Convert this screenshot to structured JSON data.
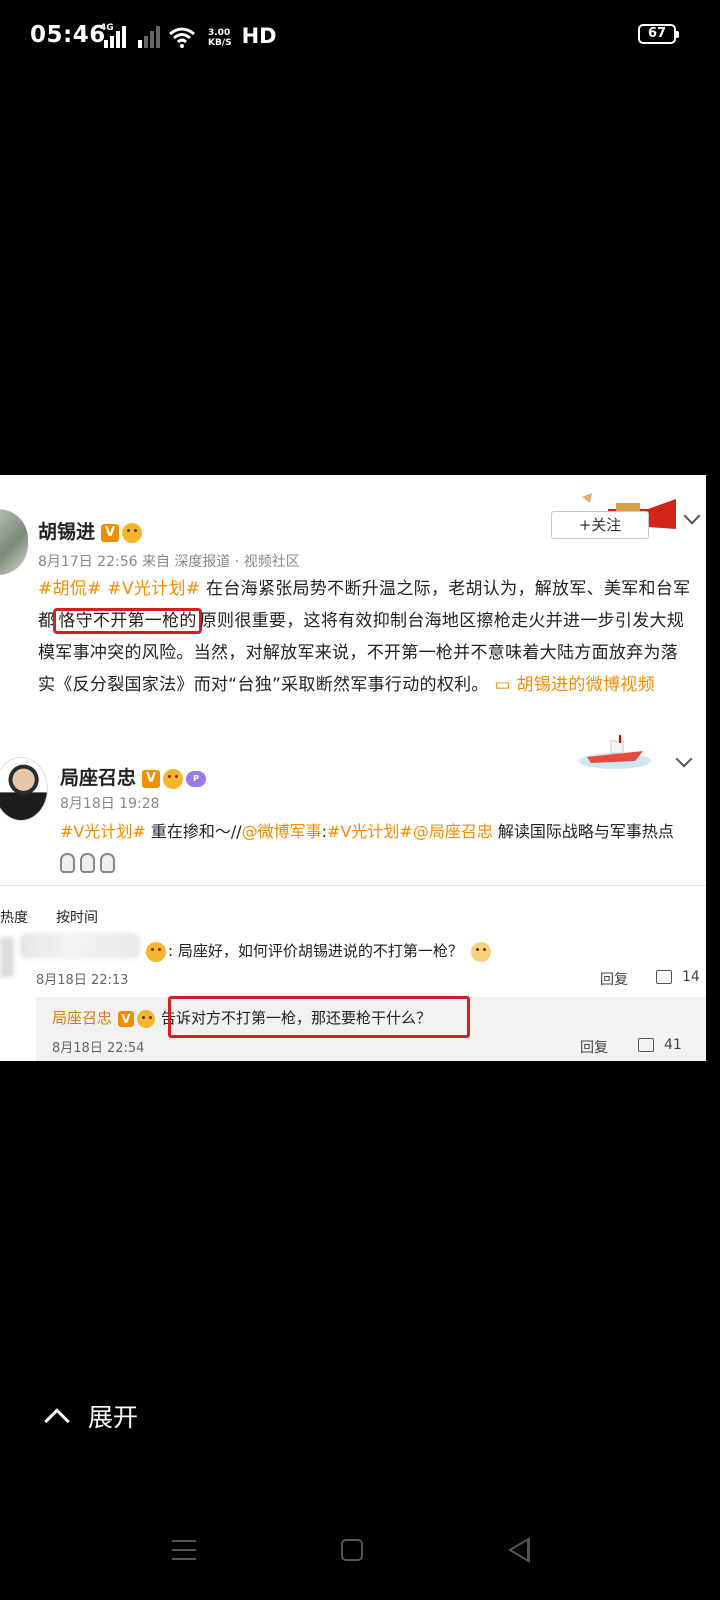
{
  "status_bar": {
    "time": "05:46",
    "network_4g": "4G",
    "speed_value": "3.00",
    "speed_unit": "KB/S",
    "hd_label": "HD",
    "battery": "67"
  },
  "post": {
    "author": "胡锡进",
    "verified_badge": "V",
    "meta": "8月17日 22:56 来自 深度报道 · 视频社区",
    "follow_label": "+关注",
    "hashtag_1": "#胡侃#",
    "hashtag_2": "#V光计划#",
    "text_1": " 在台海紧张局势不断升温之际，老胡认为，解放军、美军和台军都",
    "highlight": "恪守不开第一枪的",
    "text_2": "原则很重要，这将有效抑制台海地区擦枪走火并进一步引发大规模军事冲突的风险。当然，对解放军来说，不开第一枪并不意味着大陆方面放弃为落实《反分裂国家法》而对“台独”采取断然军事行动的权利。",
    "video_link": " ▭ 胡锡进的微博视频"
  },
  "repost": {
    "author": "局座召忠",
    "verified_badge": "V",
    "meta": "8月18日 19:28",
    "hashtag": "#V光计划#",
    "text": " 重在掺和～//",
    "mention_1": "@微博军事",
    "colon": ":",
    "hashtag_2": "#V光计划#",
    "mention_2": "@局座召忠",
    "text_2": " 解读国际战略与军事热点 "
  },
  "comments": {
    "sort_hot": "热度",
    "sort_time": "按时间",
    "comment_text": ": 局座好，如何评价胡锡进说的不打第一枪？",
    "comment_time": "8月18日 22:13",
    "reply_label": "回复",
    "comment_likes": "14",
    "reply_author": "局座召忠",
    "reply_text": "告诉对方不打第一枪，那还要枪干什么？",
    "reply_time": "8月18日 22:54",
    "reply_action": "回复",
    "reply_likes": "41"
  },
  "expand_label": "展开",
  "colors": {
    "accent": "#f28c00",
    "highlight_box": "#d21f1f",
    "background": "#000000"
  }
}
